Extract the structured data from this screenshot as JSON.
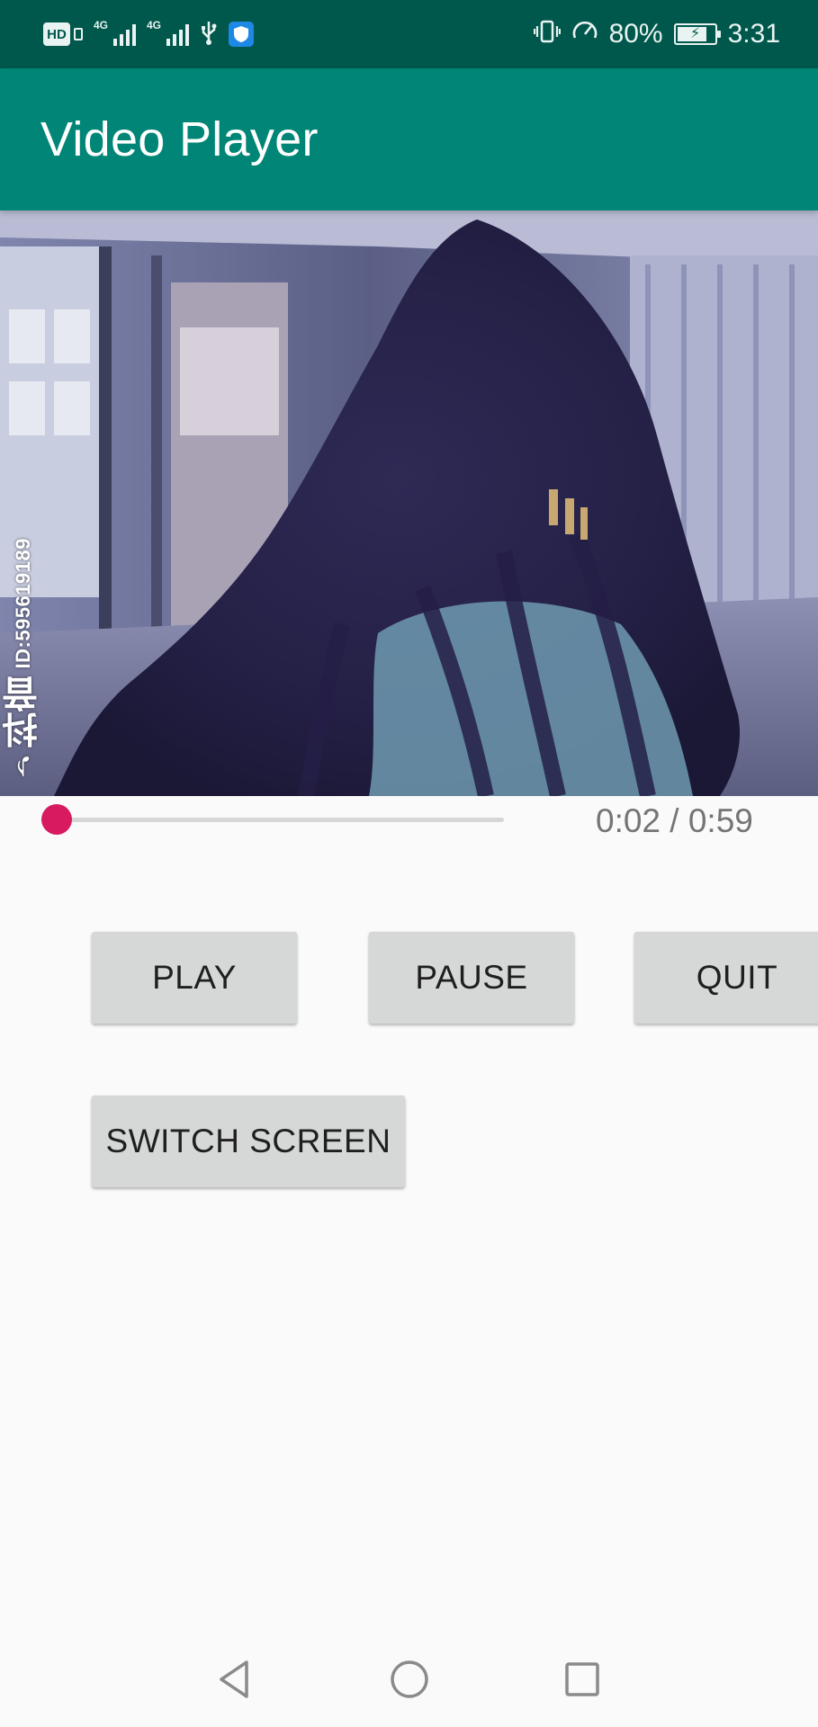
{
  "status_bar": {
    "hd_label": "HD",
    "network_1": "4G",
    "network_2": "4G",
    "battery_percent": "80%",
    "battery_level": 0.8,
    "time": "3:31",
    "icons": [
      "hd-icon",
      "signal-icon",
      "signal-icon",
      "usb-icon",
      "shield-icon",
      "vibrate-icon",
      "speedometer-icon",
      "battery-icon"
    ]
  },
  "app_bar": {
    "title": "Video Player"
  },
  "video": {
    "watermark_logo": "♪抖音",
    "watermark_id": "ID:595619189"
  },
  "player": {
    "progress_fraction": 0.034,
    "time_label": "0:02 / 0:59"
  },
  "buttons": {
    "play": "PLAY",
    "pause": "PAUSE",
    "quit": "QUIT",
    "switch_screen": "SWITCH SCREEN"
  },
  "nav_bar": {
    "icons": [
      "back-icon",
      "home-icon",
      "recent-apps-icon"
    ]
  },
  "colors": {
    "status_bar": "#00574b",
    "app_bar": "#008577",
    "accent": "#d81b60",
    "button": "#d6d7d7",
    "background": "#fafafa"
  }
}
